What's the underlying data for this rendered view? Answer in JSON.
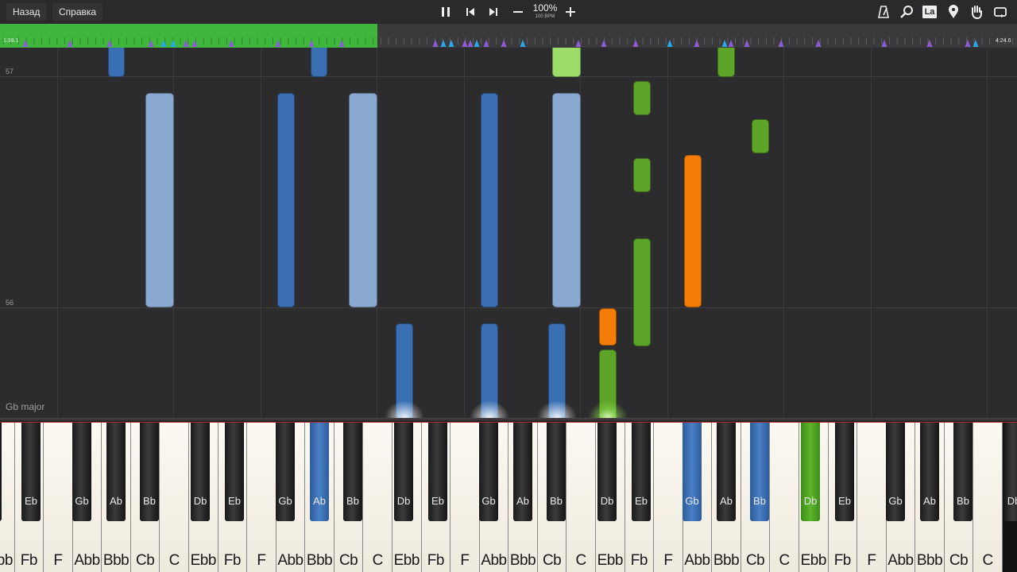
{
  "topbar": {
    "back_label": "Назад",
    "help_label": "Справка",
    "tempo_percent": "100%",
    "tempo_bpm": "100 BPM",
    "icons": [
      "metronome-icon",
      "search-icon",
      "label-icon",
      "marker-icon",
      "hand-icon",
      "loop-icon"
    ],
    "label_icon_text": "La"
  },
  "timeline": {
    "start_time": "1:38.1",
    "end_time": "4:24.6",
    "played_fraction": 0.371,
    "played_color": "#3fb73c"
  },
  "roll": {
    "row_labels": [
      "57",
      "56"
    ],
    "key_signature": "Gb major"
  },
  "colors": {
    "blue_dark": "#3a6fb3",
    "blue_light": "#8aa9d1",
    "green": "#5ea428",
    "green_light": "#9edc6a",
    "orange": "#f47d0a"
  },
  "keyboard": {
    "white_keys": [
      "Ebb",
      "Fb",
      "F",
      "Abb",
      "Bbb",
      "Cb",
      "C",
      "Ebb",
      "Fb",
      "F",
      "Abb",
      "Bbb",
      "Cb",
      "C",
      "Ebb",
      "Fb",
      "F",
      "Abb",
      "Bbb",
      "Cb",
      "C",
      "Ebb",
      "Fb",
      "F",
      "Abb",
      "Bbb",
      "Cb",
      "C",
      "Ebb",
      "Fb",
      "F",
      "Abb",
      "Bbb",
      "Cb",
      "C"
    ],
    "black_keys": [
      "Db",
      "Eb",
      "Gb",
      "Ab",
      "Bb",
      "Db",
      "Eb",
      "Gb",
      "Ab",
      "Bb",
      "Db",
      "Eb",
      "Gb",
      "Ab",
      "Bb",
      "Db",
      "Eb",
      "Gb",
      "Ab",
      "Bb",
      "Db",
      "Eb",
      "Gb",
      "Ab",
      "Bb",
      "Db"
    ]
  }
}
